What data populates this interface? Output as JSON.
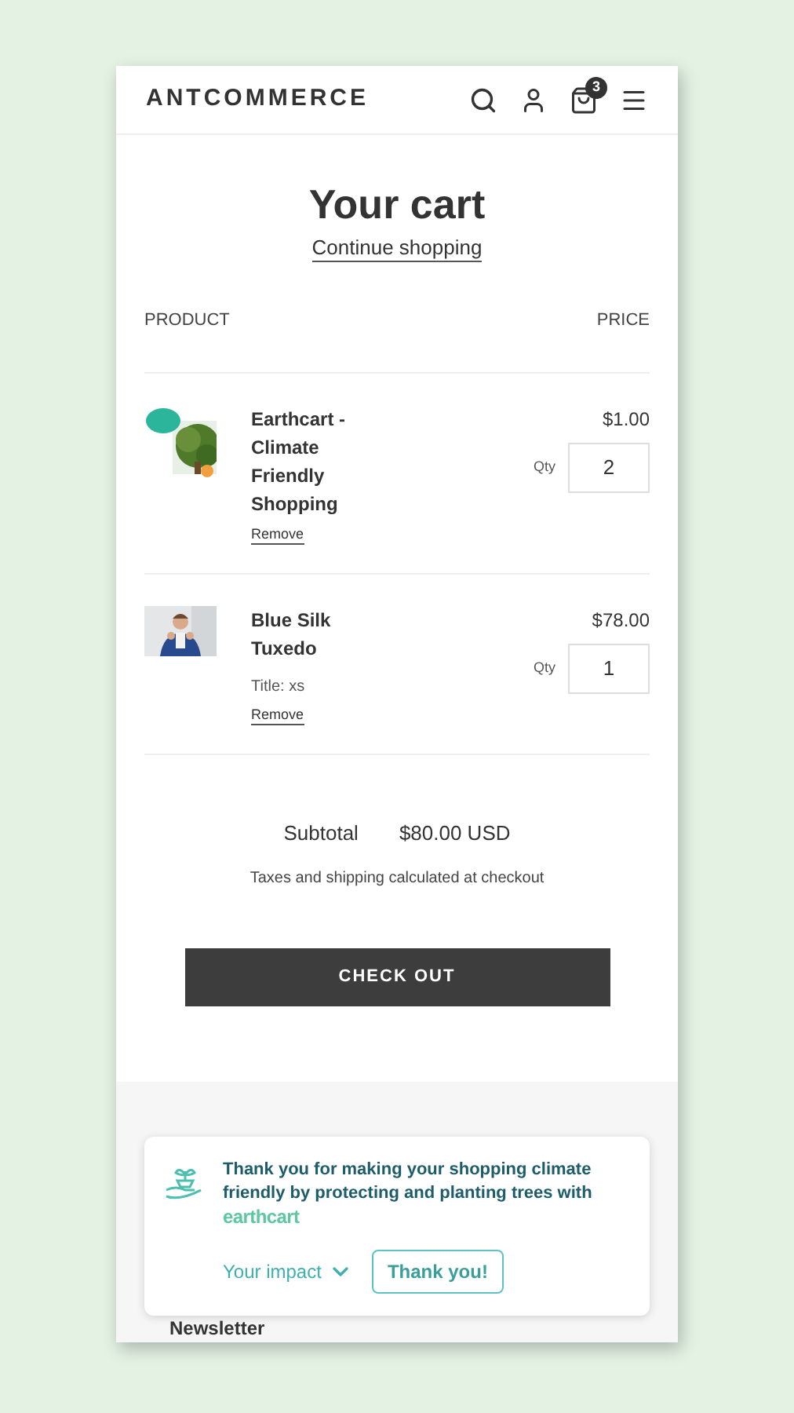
{
  "header": {
    "logo": "ANTCOMMERCE",
    "cart_count": "3"
  },
  "title": "Your cart",
  "continue_link": "Continue shopping",
  "columns": [
    "PRODUCT",
    "PRICE"
  ],
  "items": [
    {
      "name": "Earthcart - Climate Friendly Shopping",
      "remove": "Remove",
      "price": "$1.00",
      "qty_label": "Qty",
      "qty": "2",
      "kind": "tree"
    },
    {
      "name": "Blue Silk Tuxedo",
      "variant": "Title: xs",
      "remove": "Remove",
      "price": "$78.00",
      "qty_label": "Qty",
      "qty": "1",
      "kind": "person"
    }
  ],
  "subtotal_label": "Subtotal",
  "subtotal": "$80.00 USD",
  "tax_note": "Taxes and shipping calculated at checkout",
  "checkout": "CHECK OUT",
  "footer": {
    "newsletter": "Newsletter"
  },
  "popup": {
    "message": "Thank you for making your shopping climate friendly by protecting and planting trees with",
    "brand": "earthcart",
    "impact": "Your impact",
    "thanks": "Thank you!"
  }
}
